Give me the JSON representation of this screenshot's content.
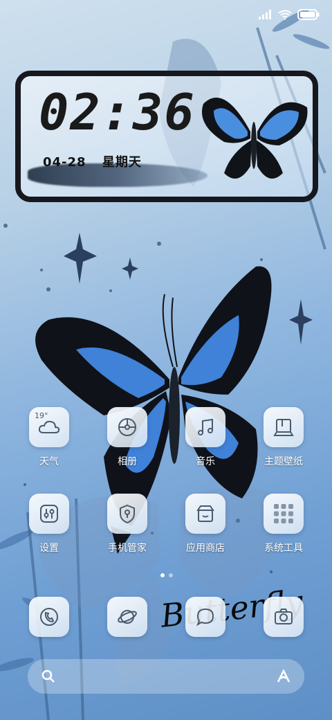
{
  "status_bar": {
    "icons": [
      "signal-icon",
      "wifi-icon",
      "battery-icon"
    ]
  },
  "clock_widget": {
    "time": "02:36",
    "date": "04-28",
    "weekday": "星期天"
  },
  "apps": [
    {
      "label": "天气",
      "icon": "weather-icon",
      "badge": "19°"
    },
    {
      "label": "相册",
      "icon": "gallery-icon"
    },
    {
      "label": "音乐",
      "icon": "music-icon"
    },
    {
      "label": "主题壁纸",
      "icon": "theme-icon"
    },
    {
      "label": "设置",
      "icon": "settings-icon"
    },
    {
      "label": "手机管家",
      "icon": "security-icon"
    },
    {
      "label": "应用商店",
      "icon": "app-store-icon"
    },
    {
      "label": "系统工具",
      "icon": "system-tools-icon"
    }
  ],
  "dock": [
    {
      "icon": "phone-icon"
    },
    {
      "icon": "browser-icon"
    },
    {
      "icon": "messages-icon"
    },
    {
      "icon": "camera-icon"
    }
  ],
  "page_indicator": {
    "pages": 2,
    "current": 1
  },
  "wallpaper_text": "Butterfly",
  "search_bar": {
    "left_icon": "search-icon",
    "right_icon": "assistant-icon"
  }
}
